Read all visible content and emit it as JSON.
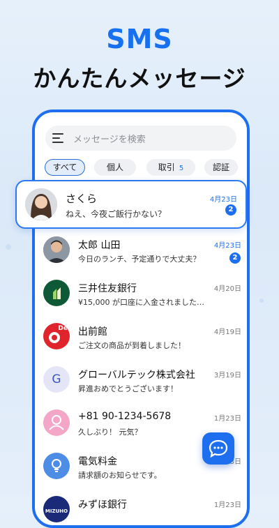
{
  "hero": {
    "title": "SMS",
    "subtitle": "かんたんメッセージ"
  },
  "search": {
    "placeholder": "メッセージを検索"
  },
  "tabs": [
    {
      "label": "すべて",
      "active": true
    },
    {
      "label": "個人"
    },
    {
      "label": "取引",
      "count": "5"
    },
    {
      "label": "認証"
    }
  ],
  "conversations": [
    {
      "name": "さくら",
      "message": "ねえ、今夜ご飯行かない？",
      "date": "4月23日",
      "unread": "2",
      "highlight": true
    },
    {
      "name": "太郎 山田",
      "message": "今日のランチ、予定通りで大丈夫？",
      "date": "4月23日",
      "unread": "2"
    },
    {
      "name": "三井住友銀行",
      "message": "¥15,000 が口座に入金されました…",
      "date": "4月20日"
    },
    {
      "name": "出前館",
      "message": "ご注文の商品が到着しました！",
      "date": "4月19日",
      "logo_text": "De"
    },
    {
      "name": "グローバルテック株式会社",
      "message": "昇進おめでとうございます！",
      "date": "3月19日",
      "initial": "G"
    },
    {
      "name": "+81 90-1234-5678",
      "message": "久しぶり！ 元気？",
      "date": "1月23日"
    },
    {
      "name": "電気料金",
      "message": "請求額のお知らせです。",
      "date": "1月23日"
    },
    {
      "name": "みずほ銀行",
      "message": "",
      "date": "1月23日",
      "logo_text": "MIZUHO"
    }
  ],
  "colors": {
    "accent": "#1e6ff0",
    "unread_date": "#1e6ff0",
    "read_date": "#777777"
  }
}
